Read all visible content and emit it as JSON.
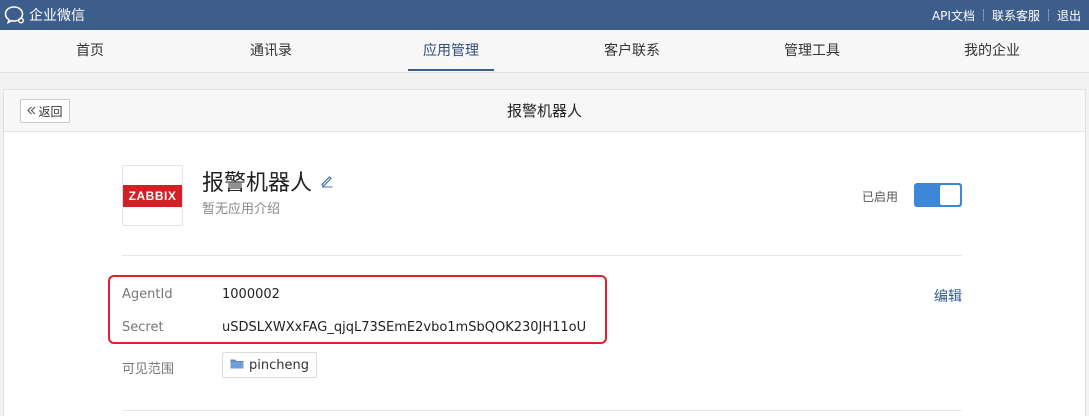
{
  "header": {
    "brand": "企业微信",
    "links": [
      "API文档",
      "联系客服",
      "退出"
    ]
  },
  "nav": {
    "items": [
      "首页",
      "通讯录",
      "应用管理",
      "客户联系",
      "管理工具",
      "我的企业"
    ],
    "active": "应用管理"
  },
  "page": {
    "back_label": "返回",
    "title": "报警机器人"
  },
  "app": {
    "logo_text": "ZABBIX",
    "name": "报警机器人",
    "description": "暂无应用介绍",
    "status_label": "已启用",
    "enabled": true
  },
  "fields": {
    "agentid_label": "AgentId",
    "agentid_value": "1000002",
    "secret_label": "Secret",
    "secret_value": "uSDSLXWXxFAG_qjqL73SEmE2vbo1mSbQOK230JH11oU",
    "edit_label": "编辑",
    "scope_label": "可见范围",
    "scope_value": "pincheng"
  },
  "colors": {
    "topbar": "#3d5d8a",
    "accent": "#3d87d8",
    "highlight_box": "#e0202a",
    "zabbix_red": "#d31f26"
  },
  "icons": {
    "logo": "chat-bubble-icon",
    "back": "double-chevron-left-icon",
    "edit": "pencil-icon",
    "scope": "folder-icon"
  }
}
